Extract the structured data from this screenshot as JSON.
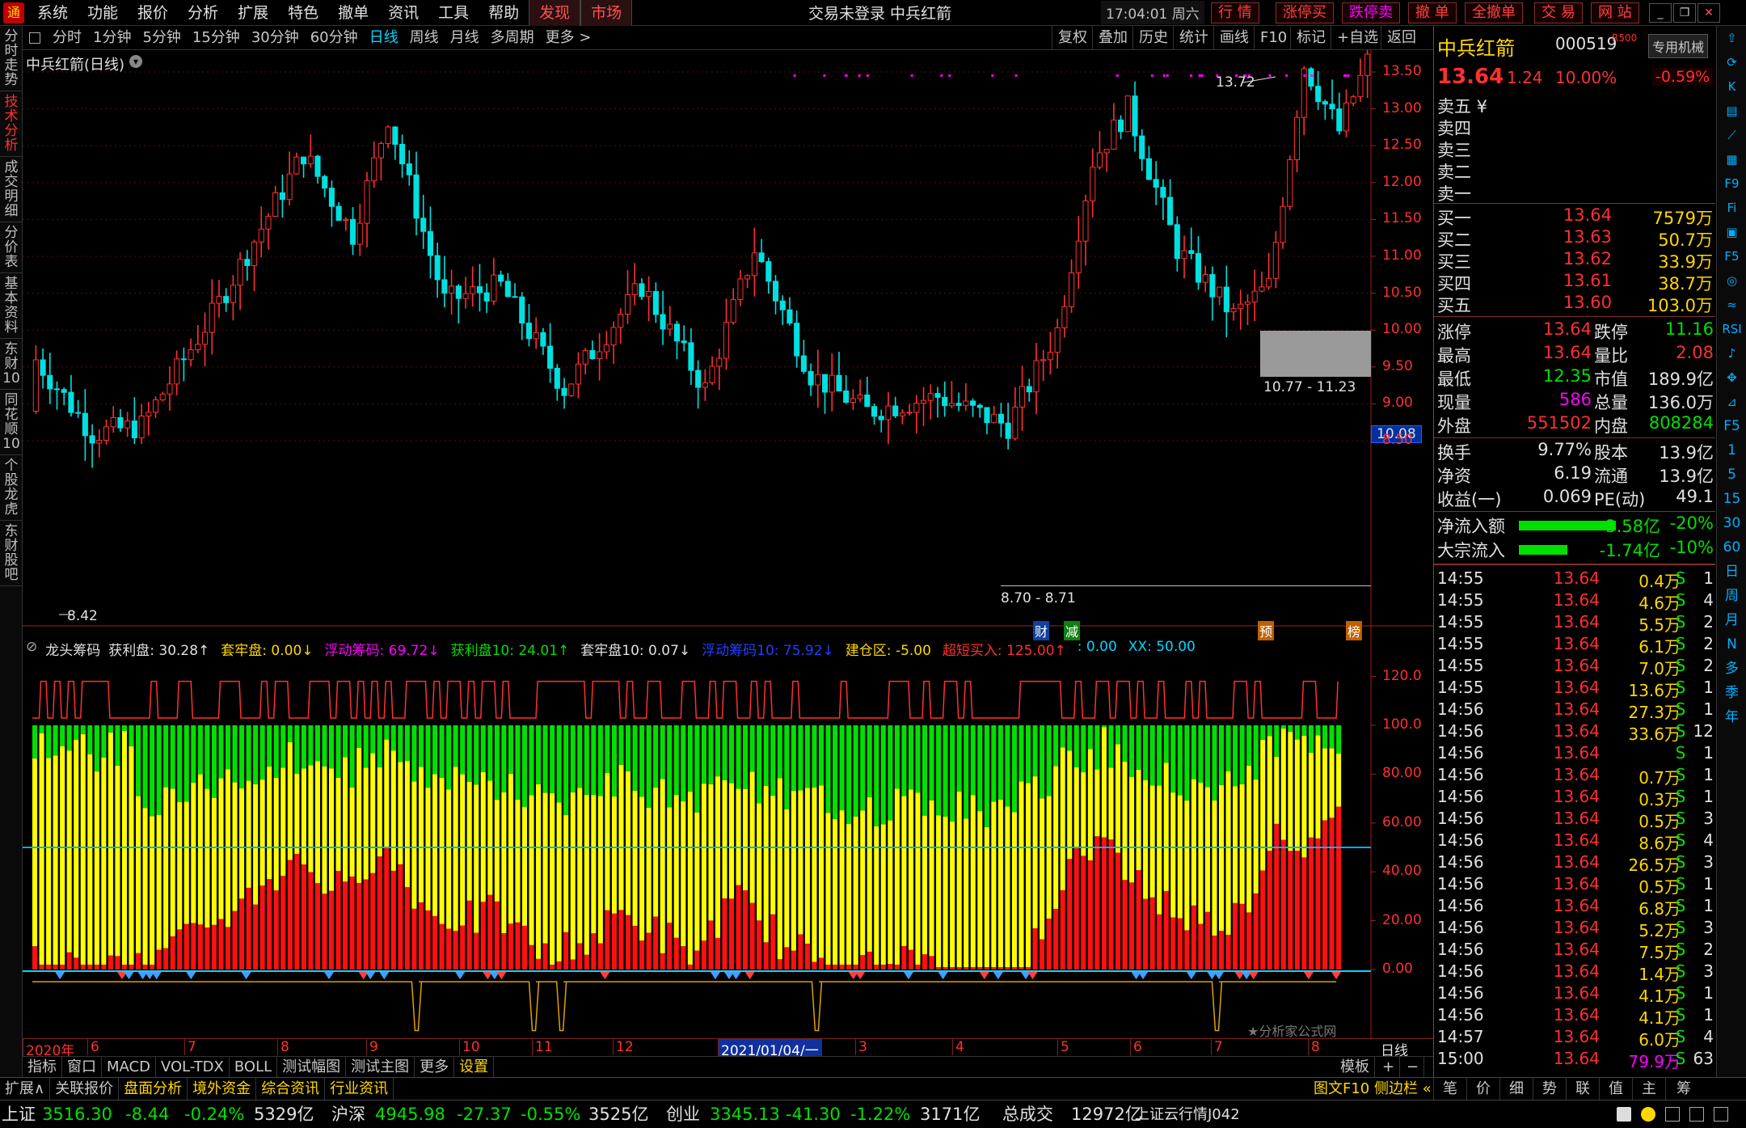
{
  "menu": {
    "items": [
      "系统",
      "功能",
      "报价",
      "分析",
      "扩展",
      "特色",
      "撤单",
      "资讯",
      "工具",
      "帮助"
    ],
    "discover": "发现",
    "market": "市场",
    "title": "交易未登录 中兵红箭",
    "clock": "17:04:01 周六",
    "quick": [
      "行 情",
      "涨停买",
      "跌停卖",
      "撤 单",
      "全撤单",
      "交 易",
      "网 站"
    ]
  },
  "left_nav": [
    "分时走势",
    "技术分析",
    "成交明细",
    "分价表",
    "基本资料",
    "东财10",
    "同花顺10",
    "个股龙虎",
    "东财股吧"
  ],
  "timeframes": {
    "items": [
      "分时",
      "1分钟",
      "5分钟",
      "15分钟",
      "30分钟",
      "60分钟",
      "日线",
      "周线",
      "月线",
      "多周期",
      "更多 >"
    ],
    "selected": "日线",
    "right": [
      "复权",
      "叠加",
      "历史",
      "统计",
      "画线",
      "F10",
      "标记",
      "+自选",
      "返回"
    ]
  },
  "chart_header": {
    "title": "中兵红箭(日线)"
  },
  "price_axis": [
    "13.50",
    "13.00",
    "12.50",
    "12.00",
    "11.50",
    "11.00",
    "10.50",
    "10.00",
    "9.50",
    "9.00",
    "8.50"
  ],
  "price_labels": {
    "high": "13.72",
    "low": "8.42",
    "current": "10.08",
    "range_high": "10.77 - 11.23",
    "range_low": "8.70 - 8.71"
  },
  "event_markers": [
    "财",
    "减",
    "预",
    "榜"
  ],
  "indicator": {
    "name": "龙头筹码",
    "fields": [
      {
        "label": "获利盘: 30.28↑",
        "color": "#e0e0e0"
      },
      {
        "label": "套牢盘: 0.00↓",
        "color": "#ffd700"
      },
      {
        "label": "浮动筹码: 69.72↓",
        "color": "#ff00ff"
      },
      {
        "label": "获利盘10: 24.01↑",
        "color": "#00e000"
      },
      {
        "label": "套牢盘10: 0.07↓",
        "color": "#e0e0e0"
      },
      {
        "label": "浮动筹码10: 75.92↓",
        "color": "#2040ff"
      },
      {
        "label": "建仓区: -5.00",
        "color": "#ffd700"
      },
      {
        "label": "超短买入: 125.00↑",
        "color": "#ff3030"
      },
      {
        "label": ": 0.00",
        "color": "#00d8ff"
      },
      {
        "label": "XX: 50.00",
        "color": "#00d8ff"
      }
    ],
    "axis": [
      "120.0",
      "100.0",
      "80.00",
      "60.00",
      "40.00",
      "20.00",
      "0.00"
    ],
    "watermark": "★分析家公式网"
  },
  "date_axis": {
    "labels": [
      "2020年",
      "6",
      "7",
      "8",
      "9",
      "10",
      "11",
      "12",
      "2021/01/04/一",
      "3",
      "4",
      "5",
      "6",
      "7",
      "8"
    ],
    "period": "日线"
  },
  "bottom_tabs": {
    "items": [
      "指标",
      "窗口",
      "MACD",
      "VOL-TDX",
      "BOLL",
      "测试幅图",
      "测试主图",
      "更多",
      "设置"
    ],
    "selected": "设置",
    "right": [
      "模板",
      "+",
      "−"
    ]
  },
  "func_bar": {
    "items": [
      "扩展∧",
      "关联报价",
      "盘面分析",
      "境外资金",
      "综合资讯",
      "行业资讯"
    ],
    "right_text": "图文F10 侧边栏 «",
    "right_tabs": [
      "笔",
      "价",
      "细",
      "势",
      "联",
      "值",
      "主",
      "筹"
    ]
  },
  "quote": {
    "name": "中兵红箭",
    "code": "000519",
    "rflag": "R500",
    "tag": "专用机械",
    "price": "13.64",
    "change": "1.24",
    "pct": "10.00%",
    "pct2": "-0.59%",
    "sells": [
      {
        "label": "卖五 ¥",
        "price": "",
        "vol": ""
      },
      {
        "label": "卖四",
        "price": "",
        "vol": ""
      },
      {
        "label": "卖三",
        "price": "",
        "vol": ""
      },
      {
        "label": "卖二",
        "price": "",
        "vol": ""
      },
      {
        "label": "卖一",
        "price": "",
        "vol": ""
      }
    ],
    "buys": [
      {
        "label": "买一",
        "price": "13.64",
        "vol": "7579万"
      },
      {
        "label": "买二",
        "price": "13.63",
        "vol": "50.7万"
      },
      {
        "label": "买三",
        "price": "13.62",
        "vol": "33.9万"
      },
      {
        "label": "买四",
        "price": "13.61",
        "vol": "38.7万"
      },
      {
        "label": "买五",
        "price": "13.60",
        "vol": "103.0万"
      }
    ],
    "stats": [
      {
        "a": "涨停",
        "b": "13.64",
        "bc": "r",
        "c": "跌停",
        "d": "11.16",
        "dc": "g"
      },
      {
        "a": "最高",
        "b": "13.64",
        "bc": "r",
        "c": "量比",
        "d": "2.08",
        "dc": "r"
      },
      {
        "a": "最低",
        "b": "12.35",
        "bc": "g",
        "c": "市值",
        "d": "189.9亿",
        "dc": "w"
      },
      {
        "a": "现量",
        "b": "586",
        "bc": "m",
        "c": "总量",
        "d": "136.0万",
        "dc": "w"
      },
      {
        "a": "外盘",
        "b": "551502",
        "bc": "r",
        "c": "内盘",
        "d": "808284",
        "dc": "g"
      },
      {
        "a": "换手",
        "b": "9.77%",
        "bc": "w",
        "c": "股本",
        "d": "13.9亿",
        "dc": "w"
      },
      {
        "a": "净资",
        "b": "6.19",
        "bc": "w",
        "c": "流通",
        "d": "13.9亿",
        "dc": "w"
      },
      {
        "a": "收益(一)",
        "b": "0.069",
        "bc": "w",
        "c": "PE(动)",
        "d": "49.1",
        "dc": "w"
      }
    ],
    "flows": [
      {
        "label": "净流入额",
        "value": "-3.58亿",
        "pct": "-20%",
        "bar": 0.2
      },
      {
        "label": "大宗流入",
        "value": "-1.74亿",
        "pct": "-10%",
        "bar": 0.1
      }
    ],
    "ticks": [
      {
        "t": "14:55",
        "p": "13.64",
        "v": "0.4万",
        "s": "S",
        "n": "1"
      },
      {
        "t": "14:55",
        "p": "13.64",
        "v": "4.6万",
        "s": "S",
        "n": "4"
      },
      {
        "t": "14:55",
        "p": "13.64",
        "v": "5.5万",
        "s": "S",
        "n": "2"
      },
      {
        "t": "14:55",
        "p": "13.64",
        "v": "6.1万",
        "s": "S",
        "n": "2"
      },
      {
        "t": "14:55",
        "p": "13.64",
        "v": "7.0万",
        "s": "S",
        "n": "2"
      },
      {
        "t": "14:55",
        "p": "13.64",
        "v": "13.6万",
        "s": "S",
        "n": "1"
      },
      {
        "t": "14:56",
        "p": "13.64",
        "v": "27.3万",
        "s": "S",
        "n": "1"
      },
      {
        "t": "14:56",
        "p": "13.64",
        "v": "33.6万",
        "s": "S",
        "n": "12"
      },
      {
        "t": "14:56",
        "p": "13.64",
        "v": "",
        "s": "S",
        "n": "1"
      },
      {
        "t": "14:56",
        "p": "13.64",
        "v": "0.7万",
        "s": "S",
        "n": "1"
      },
      {
        "t": "14:56",
        "p": "13.64",
        "v": "0.3万",
        "s": "S",
        "n": "1"
      },
      {
        "t": "14:56",
        "p": "13.64",
        "v": "0.5万",
        "s": "S",
        "n": "3"
      },
      {
        "t": "14:56",
        "p": "13.64",
        "v": "8.6万",
        "s": "S",
        "n": "4"
      },
      {
        "t": "14:56",
        "p": "13.64",
        "v": "26.5万",
        "s": "S",
        "n": "3"
      },
      {
        "t": "14:56",
        "p": "13.64",
        "v": "0.5万",
        "s": "S",
        "n": "1"
      },
      {
        "t": "14:56",
        "p": "13.64",
        "v": "6.8万",
        "s": "S",
        "n": "1"
      },
      {
        "t": "14:56",
        "p": "13.64",
        "v": "5.2万",
        "s": "S",
        "n": "3"
      },
      {
        "t": "14:56",
        "p": "13.64",
        "v": "7.5万",
        "s": "S",
        "n": "2"
      },
      {
        "t": "14:56",
        "p": "13.64",
        "v": "1.4万",
        "s": "S",
        "n": "3"
      },
      {
        "t": "14:56",
        "p": "13.64",
        "v": "4.1万",
        "s": "S",
        "n": "1"
      },
      {
        "t": "14:56",
        "p": "13.64",
        "v": "4.1万",
        "s": "S",
        "n": "1"
      },
      {
        "t": "14:57",
        "p": "13.64",
        "v": "6.0万",
        "s": "S",
        "n": "4"
      },
      {
        "t": "15:00",
        "p": "13.64",
        "v": "79.9万",
        "s": "S",
        "n": "63"
      }
    ]
  },
  "right_icons": [
    "up-icon",
    "refresh-icon",
    "k-icon",
    "bar-icon",
    "line-icon",
    "chart-icon",
    "f9-icon",
    "f10-icon",
    "doc-icon",
    "f5-icon",
    "circle-icon",
    "macd-icon",
    "rsi-icon",
    "sound-icon",
    "move-icon",
    "ruler-icon"
  ],
  "right_periods": [
    "F5",
    "1",
    "5",
    "15",
    "30",
    "60",
    "日",
    "周",
    "月",
    "N",
    "多",
    "季",
    "年"
  ],
  "status": {
    "sh_name": "上证",
    "sh_val": "3516.30",
    "sh_chg": "-8.44",
    "sh_pct": "-0.24%",
    "sh_amt": "5329亿",
    "sz_name": "沪深",
    "sz_val": "4945.98",
    "sz_chg": "-27.37",
    "sz_pct": "-0.55%",
    "sz_amt": "3525亿",
    "cy_name": "创业",
    "cy_val": "3345.13",
    "cy_chg": "-41.30",
    "cy_pct": "-1.22%",
    "cy_amt": "3171亿",
    "total_label": "总成交",
    "total_val": "12972亿",
    "cloud": "上证云行情J042"
  }
}
